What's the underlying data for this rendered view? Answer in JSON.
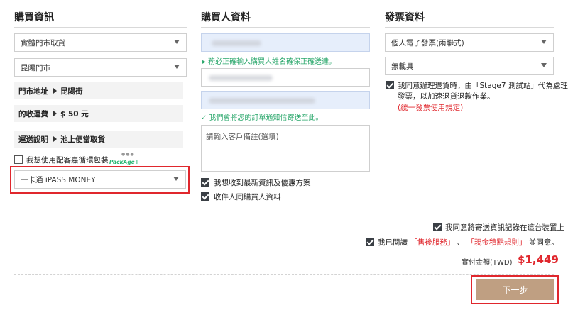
{
  "columns": {
    "purchase_title": "購買資訊",
    "buyer_title": "購買人資料",
    "invoice_title": "發票資料"
  },
  "purchase": {
    "delivery_select": "實體門市取貨",
    "store_select": "昆陽門市",
    "address_label": "門市地址",
    "address_value": "昆陽街",
    "fee_label": "的收運費",
    "fee_value": "$ 50 元",
    "shipping_label": "運送說明",
    "shipping_value": "池上便當取貨",
    "eco_package_label": "我想使用配客嘉循環包裝",
    "eco_package_logo": "PackAge+",
    "payment_select": "一卡通 iPASS MONEY"
  },
  "buyer": {
    "name_hint": "務必正確輸入購買人姓名確保正確送達。",
    "email_hint": "我們會將您的訂單通知信寄送至此。",
    "remark_placeholder": "請輸入客戶備註(選填)",
    "subscribe_label": "我想收到最新資訊及優惠方案",
    "same_recipient_label": "收件人同購買人資料"
  },
  "invoice": {
    "type_select": "個人電子發票(兩聯式)",
    "carrier_select": "無載具",
    "agree_line1": "我同意辦理退貨時，由「Stage7 測試站」代為處理",
    "agree_line2": "發票，以加速退貨退款作業。",
    "rule_link": "(統一發票使用規定)"
  },
  "footer": {
    "remember_label": "我同意將寄送資訊記錄在這台裝置上",
    "terms_prefix": "我已閱讀",
    "terms_service": "售後服務",
    "terms_sep": "、",
    "terms_points": "現金積點規則",
    "terms_suffix": "並同意。",
    "total_label": "實付金額(TWD)",
    "total_value": "$1,449",
    "next_button": "下一步"
  },
  "colors": {
    "accent_red": "#e0272d",
    "button_brown": "#bf9f82",
    "hint_green": "#2aa76b",
    "checkbox_dark": "#3a3f45"
  }
}
